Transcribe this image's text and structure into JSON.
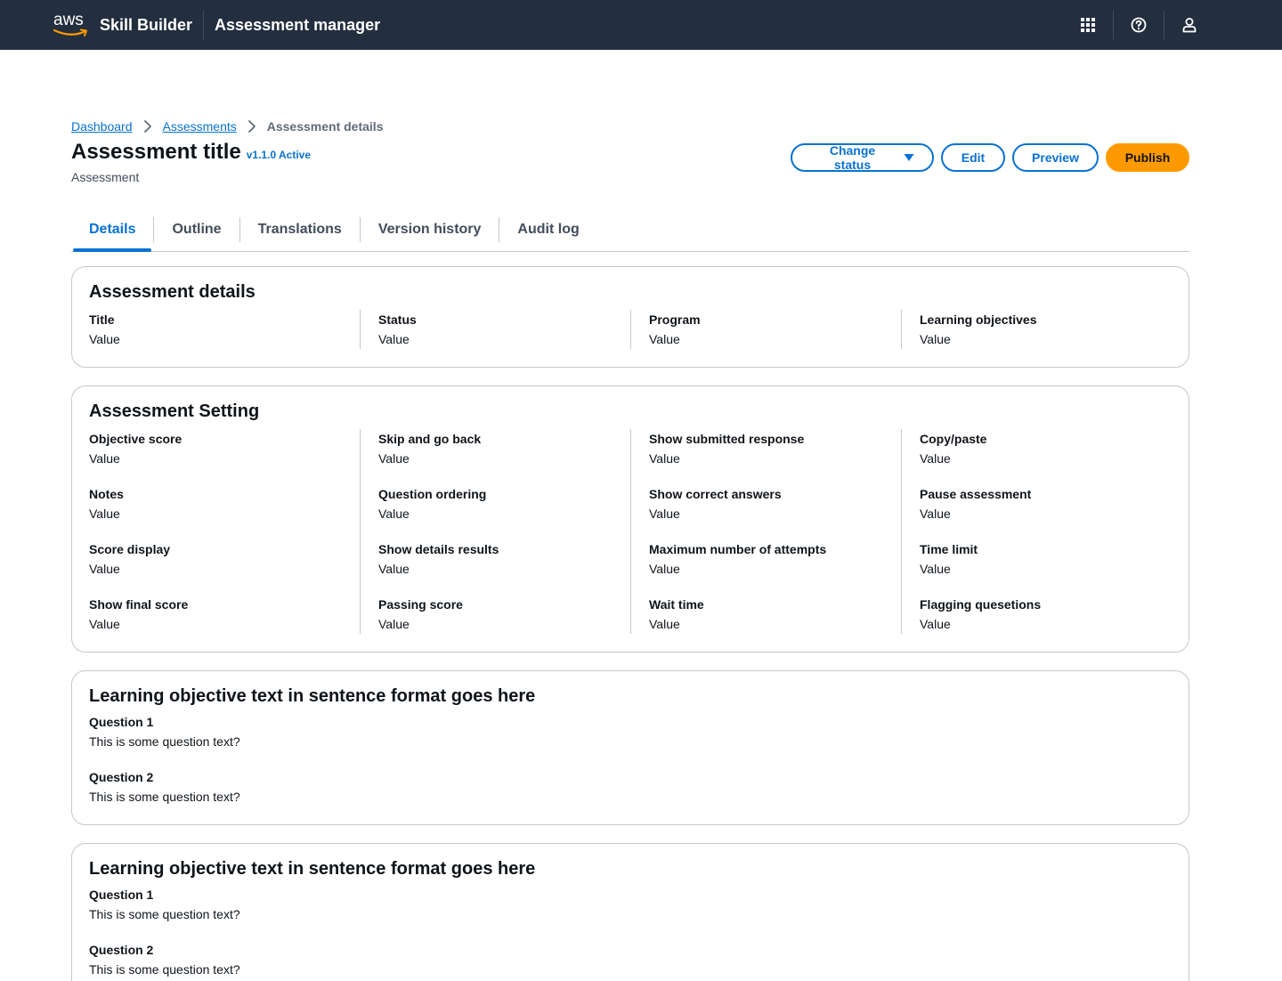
{
  "header": {
    "logo_text": "aws",
    "product_name": "Skill Builder",
    "app_name": "Assessment manager",
    "icons": [
      "apps-grid-icon",
      "help-icon",
      "user-icon"
    ]
  },
  "breadcrumb": {
    "items": [
      "Dashboard",
      "Assessments"
    ],
    "current": "Assessment details"
  },
  "page": {
    "title": "Assessment title",
    "version": "v1.1.0 Active",
    "subtitle": "Assessment"
  },
  "actions": {
    "change_status": "Change status",
    "edit": "Edit",
    "preview": "Preview",
    "publish": "Publish"
  },
  "tabs": [
    {
      "label": "Details",
      "active": true
    },
    {
      "label": "Outline",
      "active": false
    },
    {
      "label": "Translations",
      "active": false
    },
    {
      "label": "Version history",
      "active": false
    },
    {
      "label": "Audit log",
      "active": false
    }
  ],
  "details_card": {
    "title": "Assessment details",
    "columns": [
      [
        {
          "key": "Title",
          "value": "Value"
        }
      ],
      [
        {
          "key": "Status",
          "value": "Value"
        }
      ],
      [
        {
          "key": "Program",
          "value": "Value"
        }
      ],
      [
        {
          "key": "Learning objectives",
          "value": "Value"
        }
      ]
    ]
  },
  "settings_card": {
    "title": "Assessment Setting",
    "columns": [
      [
        {
          "key": "Objective score",
          "value": "Value"
        },
        {
          "key": "Notes",
          "value": "Value"
        },
        {
          "key": "Score display",
          "value": "Value"
        },
        {
          "key": "Show final score",
          "value": "Value"
        }
      ],
      [
        {
          "key": "Skip and go back",
          "value": "Value"
        },
        {
          "key": "Question ordering",
          "value": "Value"
        },
        {
          "key": "Show details results",
          "value": "Value"
        },
        {
          "key": "Passing score",
          "value": "Value"
        }
      ],
      [
        {
          "key": "Show submitted response",
          "value": "Value"
        },
        {
          "key": "Show correct answers",
          "value": "Value"
        },
        {
          "key": "Maximum number of attempts",
          "value": "Value"
        },
        {
          "key": "Wait time",
          "value": "Value"
        }
      ],
      [
        {
          "key": "Copy/paste",
          "value": "Value"
        },
        {
          "key": "Pause assessment",
          "value": "Value"
        },
        {
          "key": "Time limit",
          "value": "Value"
        },
        {
          "key": "Flagging quesetions",
          "value": "Value"
        }
      ]
    ]
  },
  "objectives": [
    {
      "title": "Learning objective text in sentence format goes here",
      "questions": [
        {
          "label": "Question 1",
          "text": "This is some question text?"
        },
        {
          "label": "Question 2",
          "text": "This is some question text?"
        }
      ]
    },
    {
      "title": "Learning objective text in sentence format goes here",
      "questions": [
        {
          "label": "Question 1",
          "text": "This is some question text?"
        },
        {
          "label": "Question 2",
          "text": "This is some question text?"
        }
      ]
    }
  ],
  "colors": {
    "topbar": "#232f3e",
    "link": "#0972d3",
    "primary": "#ff9900",
    "border": "#c6c6cd",
    "text": "#0f141a"
  }
}
